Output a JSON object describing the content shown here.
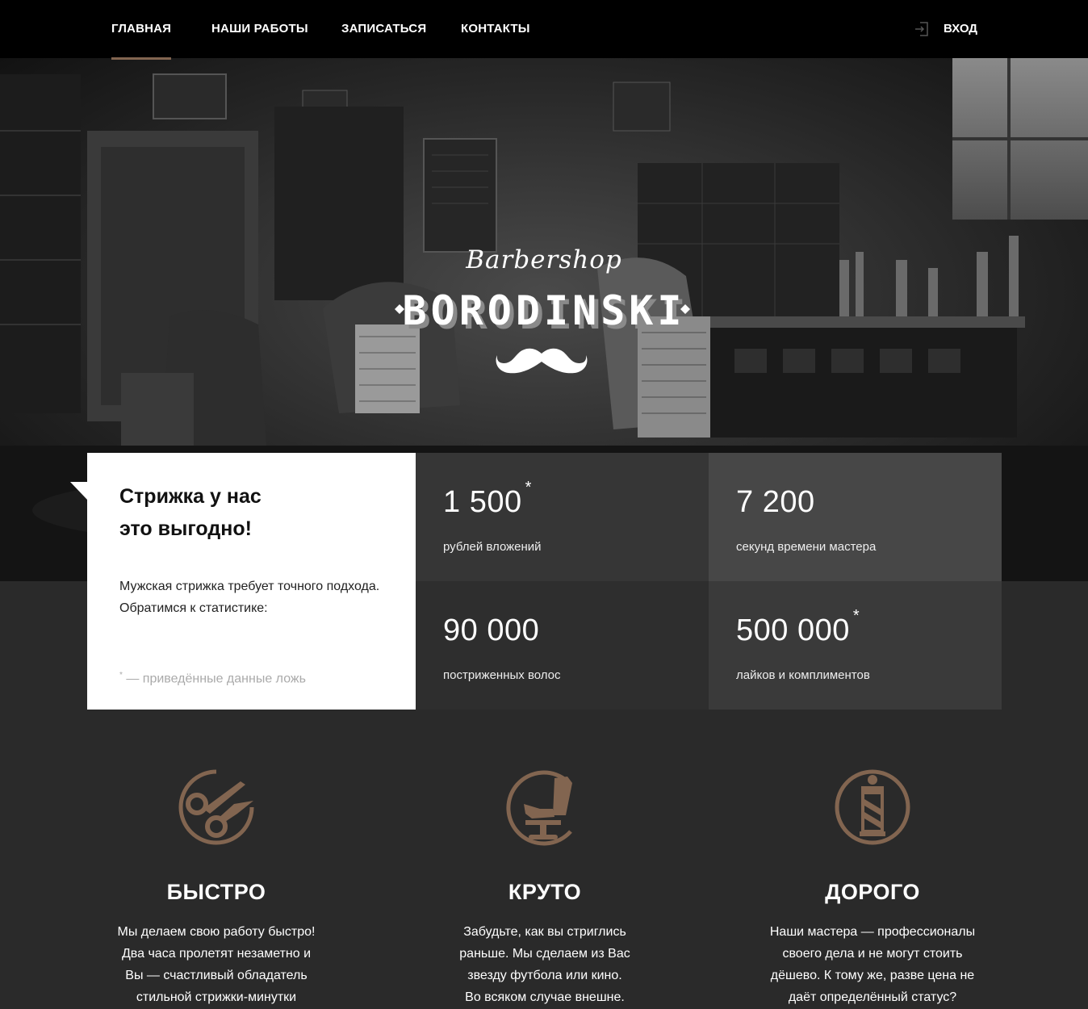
{
  "nav": {
    "items": [
      {
        "label": "ГЛАВНАЯ",
        "active": true
      },
      {
        "label": "НАШИ РАБОТЫ",
        "active": false
      },
      {
        "label": "ЗАПИСАТЬСЯ",
        "active": false
      },
      {
        "label": "КОНТАКТЫ",
        "active": false
      }
    ],
    "login_label": "ВХОД",
    "login_icon": "login-icon",
    "accent_color": "#826550"
  },
  "hero": {
    "script_title": "Barbershop",
    "brand_name": "BORODINSKI",
    "logo_icon": "mustache-icon"
  },
  "promo": {
    "title_line1": "Стрижка у нас",
    "title_line2": "это выгодно!",
    "text_line1": "Мужская стрижка требует точного подхода.",
    "text_line2": "Обратимся к статистике:",
    "note_star": "*",
    "note_text": "— приведённые данные ложь"
  },
  "stats": [
    {
      "value": "1 500",
      "star": "*",
      "label": "рублей вложений"
    },
    {
      "value": "7 200",
      "star": "",
      "label": "секунд времени мастера"
    },
    {
      "value": "90 000",
      "star": "",
      "label": "постриженных волос"
    },
    {
      "value": "500 000",
      "star": "*",
      "label": "лайков и комплиментов"
    }
  ],
  "features": [
    {
      "icon": "scissors-icon",
      "title": "БЫСТРО",
      "lines": [
        "Мы делаем свою работу быстро!",
        "Два часа пролетят незаметно и",
        "Вы — счастливый обладатель",
        "стильной стрижки-минутки"
      ]
    },
    {
      "icon": "barber-chair-icon",
      "title": "КРУТО",
      "lines": [
        "Забудьте, как вы стриглись",
        "раньше. Мы сделаем из Вас",
        "звезду футбола или кино.",
        "Во всяком случае внешне."
      ]
    },
    {
      "icon": "barber-pole-icon",
      "title": "ДОРОГО",
      "lines": [
        "Наши мастера — профессионалы",
        "своего дела и не могут стоить",
        "дёшево. К тому же, разве цена не",
        "даёт определённый статус?"
      ]
    }
  ]
}
